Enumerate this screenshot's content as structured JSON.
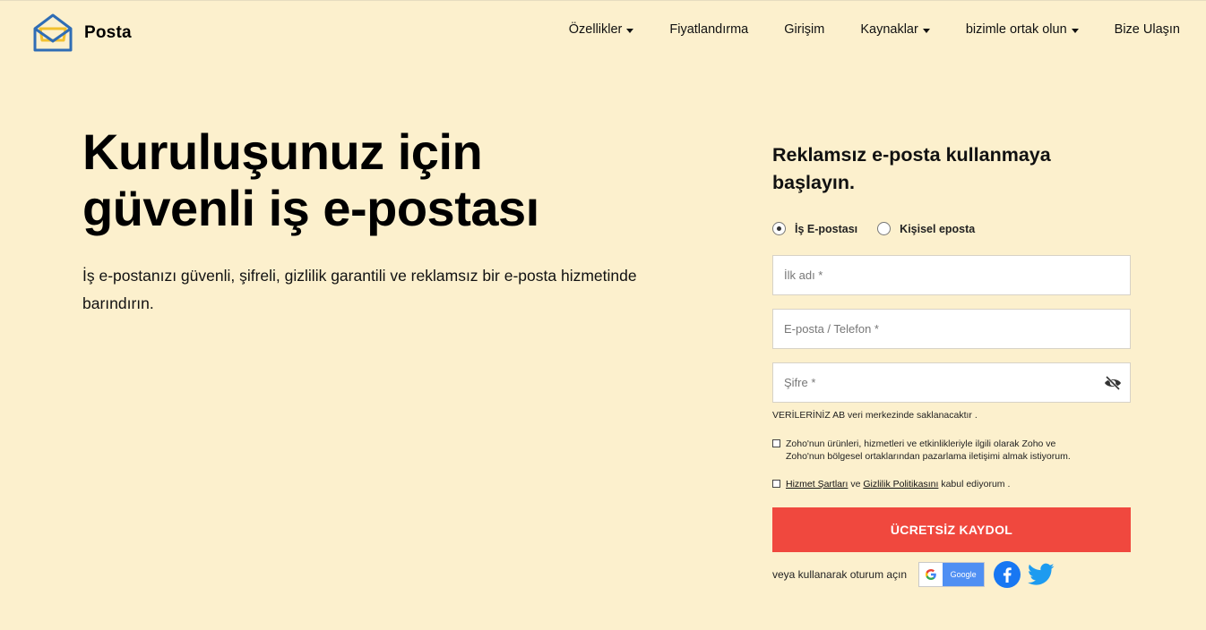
{
  "brand": {
    "name": "Posta"
  },
  "nav": {
    "items": [
      {
        "label": "Özellikler",
        "has_dropdown": true
      },
      {
        "label": "Fiyatlandırma",
        "has_dropdown": false
      },
      {
        "label": "Girişim",
        "has_dropdown": false
      },
      {
        "label": "Kaynaklar",
        "has_dropdown": true
      },
      {
        "label": "bizimle ortak olun",
        "has_dropdown": true
      },
      {
        "label": "Bize Ulaşın",
        "has_dropdown": false
      }
    ]
  },
  "hero": {
    "title_line1": "Kuruluşunuz için",
    "title_line2": "güvenli iş e-postası",
    "subtitle": "İş e-postanızı güvenli, şifreli, gizlilik garantili ve reklamsız bir e-posta hizmetinde barındırın."
  },
  "form": {
    "title": "Reklamsız e-posta kullanmaya başlayın.",
    "radio_business": "İş E-postası",
    "radio_personal": "Kişisel eposta",
    "selected": "business",
    "first_name_placeholder": "İlk adı *",
    "email_placeholder": "E-posta / Telefon *",
    "password_placeholder": "Şifre *",
    "data_note": "VERİLERİNİZ AB veri merkezinde saklanacaktır .",
    "marketing_consent_line1": "Zoho'nun ürünleri, hizmetleri ve etkinlikleriyle ilgili olarak Zoho ve",
    "marketing_consent_line2": "Zoho'nun bölgesel ortaklarından pazarlama iletişimi almak istiyorum.",
    "terms_link": "Hizmet Şartları",
    "terms_and": " ve ",
    "privacy_link": "Gizlilik Politikasını",
    "terms_suffix": " kabul ediyorum .",
    "submit_label": "ÜCRETSİZ KAYDOL",
    "social_label": "veya kullanarak oturum açın",
    "google_label": "Google"
  },
  "colors": {
    "background": "#fcf0cd",
    "submit": "#f0483e",
    "google": "#4f8ff3",
    "facebook": "#1877f2",
    "twitter": "#1d9bf0",
    "logo_blue": "#2f6db5",
    "logo_yellow": "#f2c12e"
  },
  "icons": {
    "logo": "open-envelope-icon",
    "dropdown": "caret-down-icon",
    "password_toggle": "eye-slash-icon",
    "google": "google-g-icon",
    "facebook": "facebook-icon",
    "twitter": "twitter-bird-icon"
  }
}
